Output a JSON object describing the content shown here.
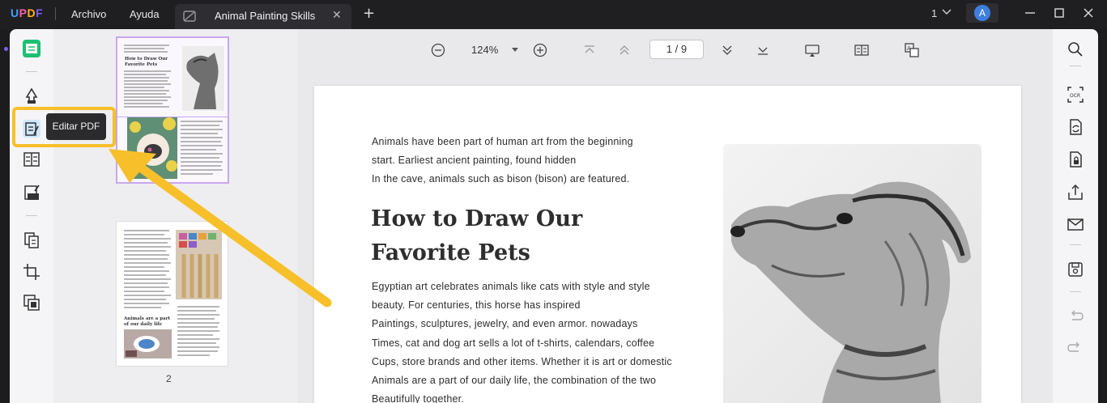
{
  "app": {
    "logo": {
      "u": "U",
      "p": "P",
      "d": "D",
      "f": "F"
    },
    "menu": [
      "Archivo",
      "Ayuda"
    ],
    "tab_title": "Animal Painting Skills",
    "page_count": "1",
    "avatar_letter": "A"
  },
  "left_toolbar": {
    "tooltip": "Editar PDF",
    "tools": [
      "reader-icon",
      "comment-icon",
      "edit-pdf-icon",
      "form-icon",
      "sign-icon",
      "organize-pages-icon",
      "crop-icon",
      "layers-icon"
    ]
  },
  "thumbnails": {
    "page1_title": "How to Draw Our Favorite Pets",
    "page2_heading": "Animals are a part of our daily life",
    "page2_label": "2"
  },
  "viewer_toolbar": {
    "zoom": "124%",
    "page_indicator": "1 / 9"
  },
  "document": {
    "intro": [
      "Animals have been part of human art from the beginning",
      "start. Earliest ancient painting, found hidden",
      "In the cave, animals such as bison (bison) are featured."
    ],
    "heading_lines": [
      "How to Draw Our",
      "Favorite Pets"
    ],
    "body": [
      "Egyptian art celebrates animals like cats with style and style",
      "beauty. For centuries, this horse has inspired",
      "Paintings, sculptures, jewelry, and even armor. nowadays",
      "Times, cat and dog art sells a lot of t-shirts, calendars, coffee",
      "Cups, store brands and other items. Whether it is art or domestic",
      "Animals are a part of our daily life, the combination of the two",
      "Beautifully together."
    ]
  },
  "right_toolbar": {
    "tools": [
      "search-icon",
      "ocr-icon",
      "convert-icon",
      "protect-icon",
      "share-icon",
      "email-icon",
      "save-icon",
      "undo-icon",
      "redo-icon"
    ]
  },
  "colors": {
    "highlight": "#f7c02a",
    "accent": "#7c5cff",
    "avatar": "#3d7fe0"
  }
}
